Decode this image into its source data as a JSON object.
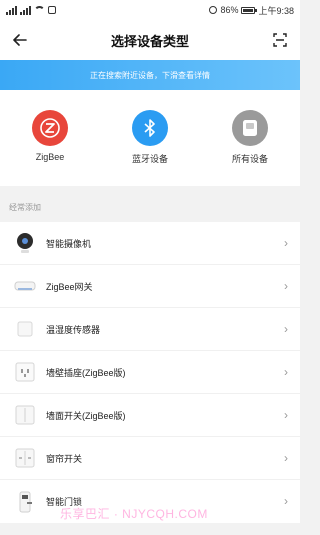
{
  "status_bar": {
    "battery_percent": "86%",
    "time": "上午9:38"
  },
  "header": {
    "title": "选择设备类型",
    "back_icon": "arrow-left-icon",
    "scan_icon": "scan-icon"
  },
  "banner": {
    "text": "正在搜索附近设备，下滑查看详情"
  },
  "quick_options": [
    {
      "label": "ZigBee",
      "icon": "zigbee-icon",
      "color": "#e8463b"
    },
    {
      "label": "蓝牙设备",
      "icon": "bluetooth-icon",
      "color": "#2b9cf2"
    },
    {
      "label": "所有设备",
      "icon": "all-devices-icon",
      "color": "#9a9a9a"
    }
  ],
  "section_label": "经常添加",
  "devices": [
    {
      "label": "智能摄像机",
      "icon": "camera-icon"
    },
    {
      "label": "ZigBee网关",
      "icon": "gateway-icon"
    },
    {
      "label": "温湿度传感器",
      "icon": "sensor-icon"
    },
    {
      "label": "墙壁插座(ZigBee版)",
      "icon": "socket-icon"
    },
    {
      "label": "墙面开关(ZigBee版)",
      "icon": "wall-switch-icon"
    },
    {
      "label": "窗帘开关",
      "icon": "curtain-switch-icon"
    },
    {
      "label": "智能门锁",
      "icon": "door-lock-icon"
    }
  ],
  "watermark": "乐享巴汇 · NJYCQH.COM"
}
